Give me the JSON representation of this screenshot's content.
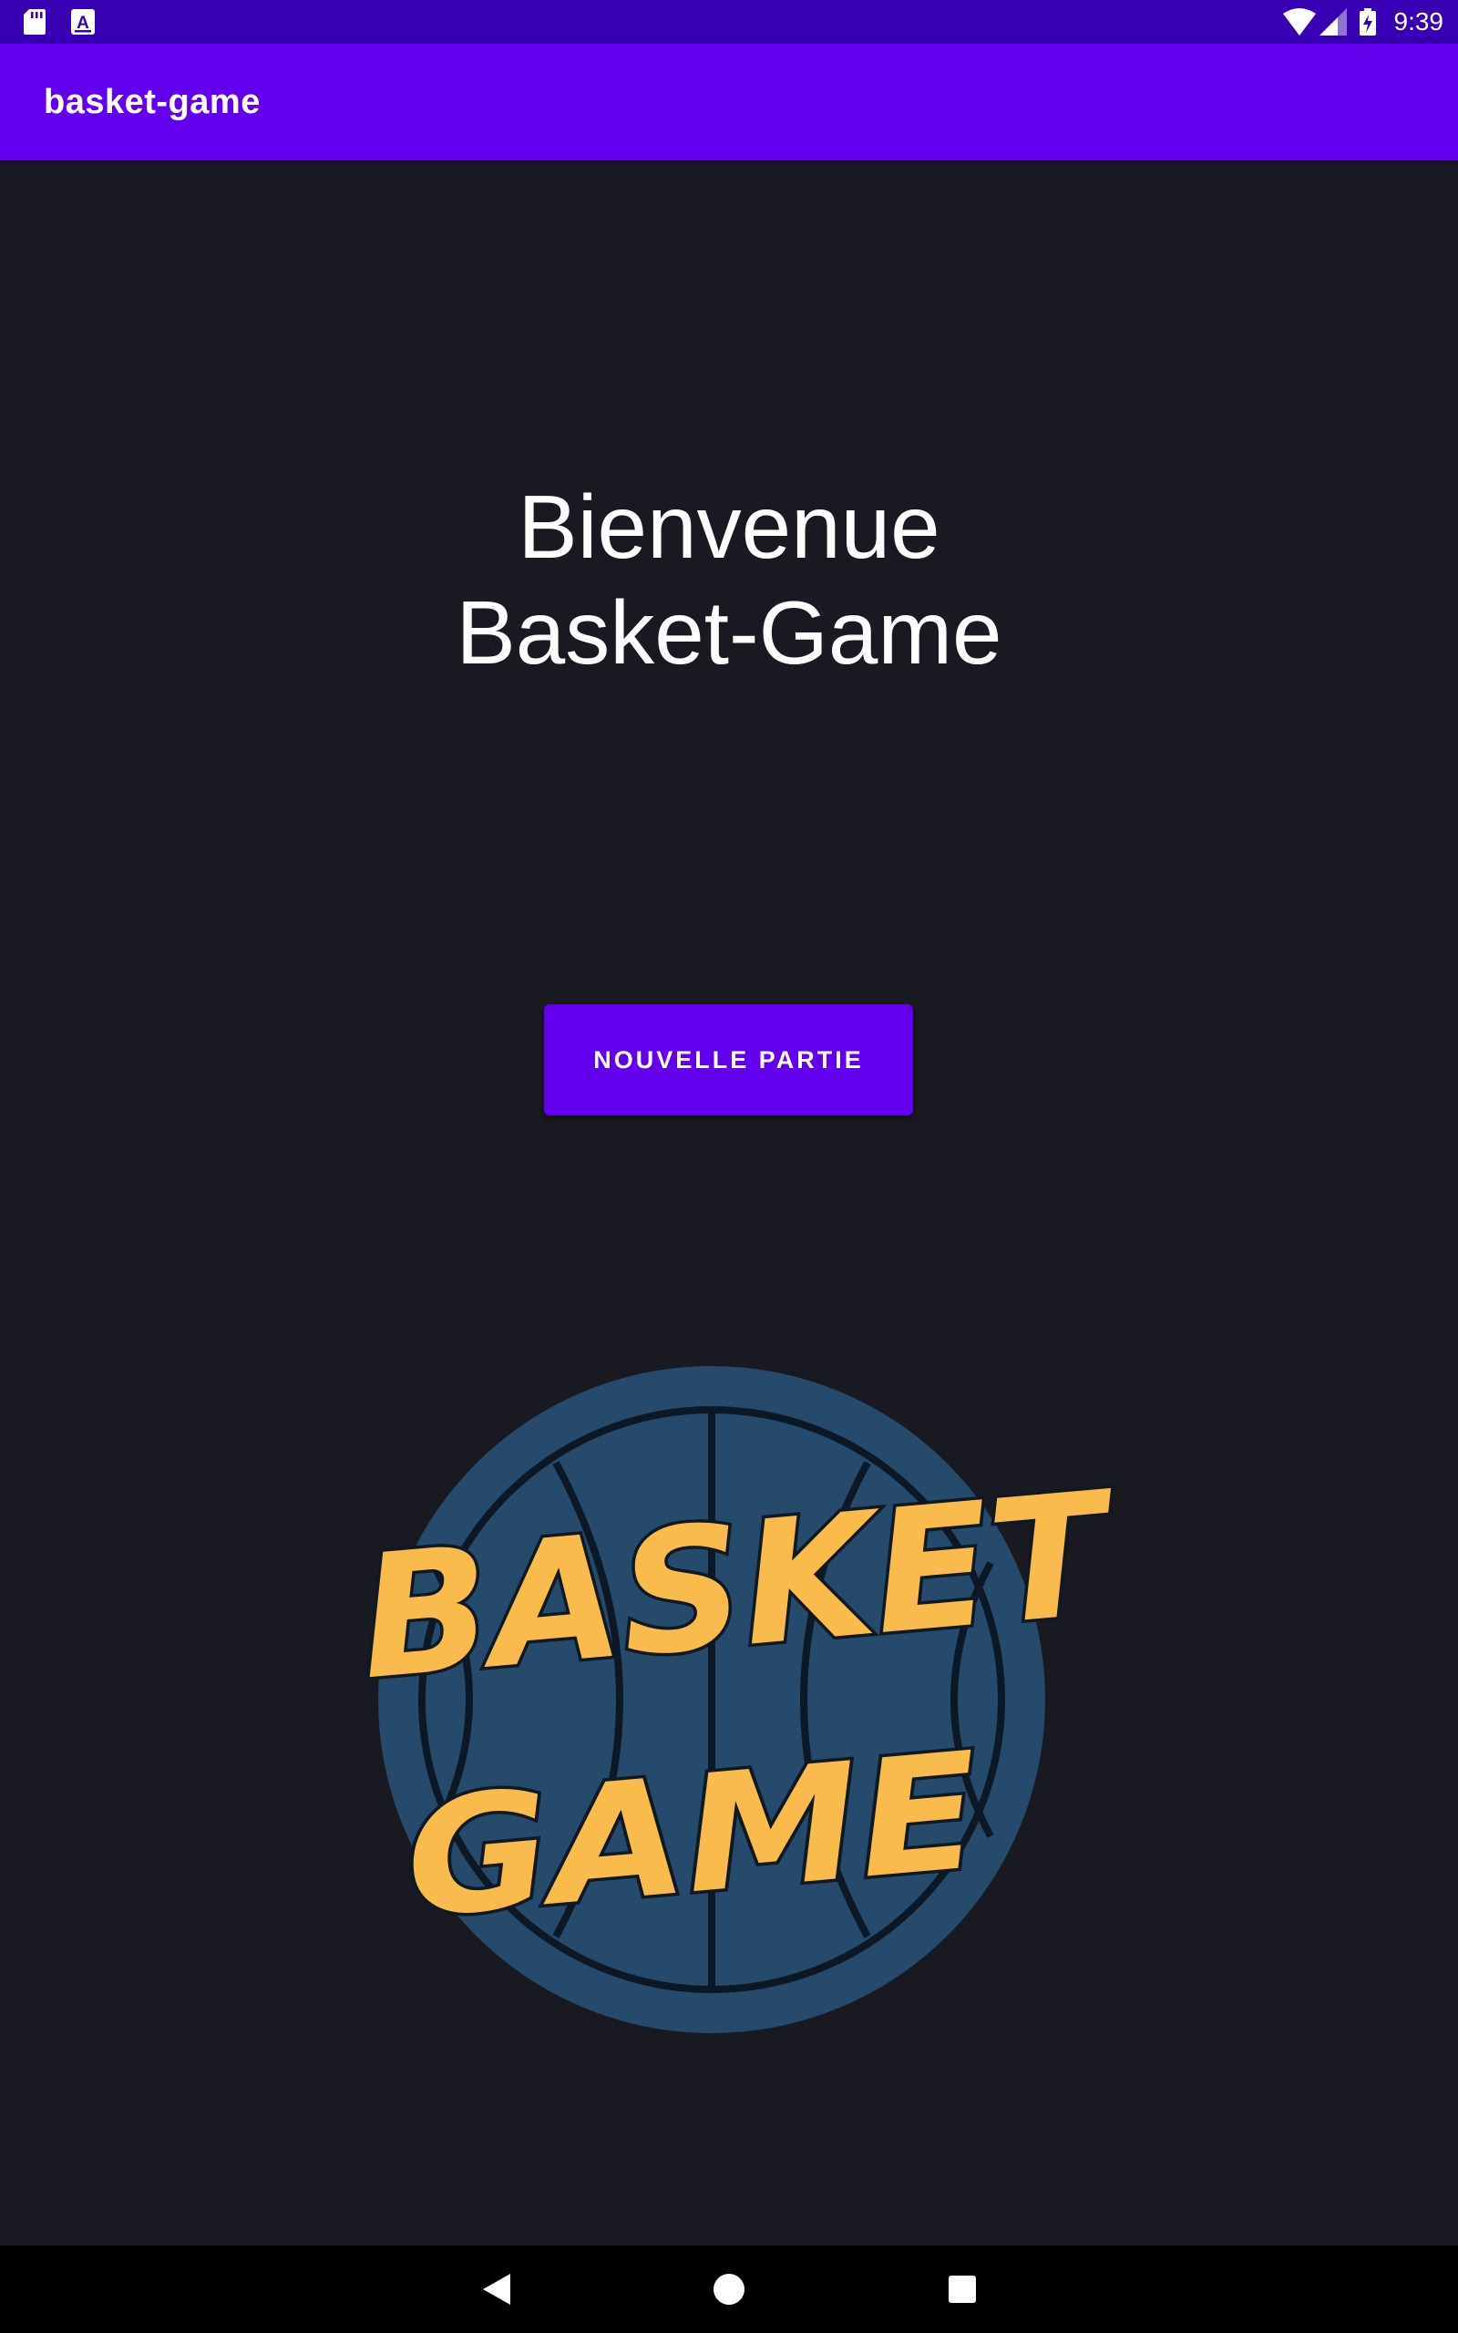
{
  "status_bar": {
    "time": "9:39",
    "icons": [
      "sd-card-icon",
      "a-notification-icon",
      "wifi-icon",
      "cell-signal-icon",
      "battery-charging-icon"
    ]
  },
  "app_bar": {
    "title": "basket-game"
  },
  "main": {
    "welcome_line1": "Bienvenue",
    "welcome_line2": "Basket-Game",
    "new_game_button": "NOUVELLE PARTIE",
    "logo": {
      "word1": "BASKET",
      "word2": "GAME"
    }
  },
  "nav_bar": {
    "icons": [
      "back-icon",
      "home-icon",
      "recents-icon"
    ]
  },
  "colors": {
    "status_bar": "#3700b3",
    "app_bar": "#6200ee",
    "background": "#191921",
    "button": "#6200ee",
    "logo_ball": "#254a6c",
    "logo_text": "#f9bc4c"
  }
}
